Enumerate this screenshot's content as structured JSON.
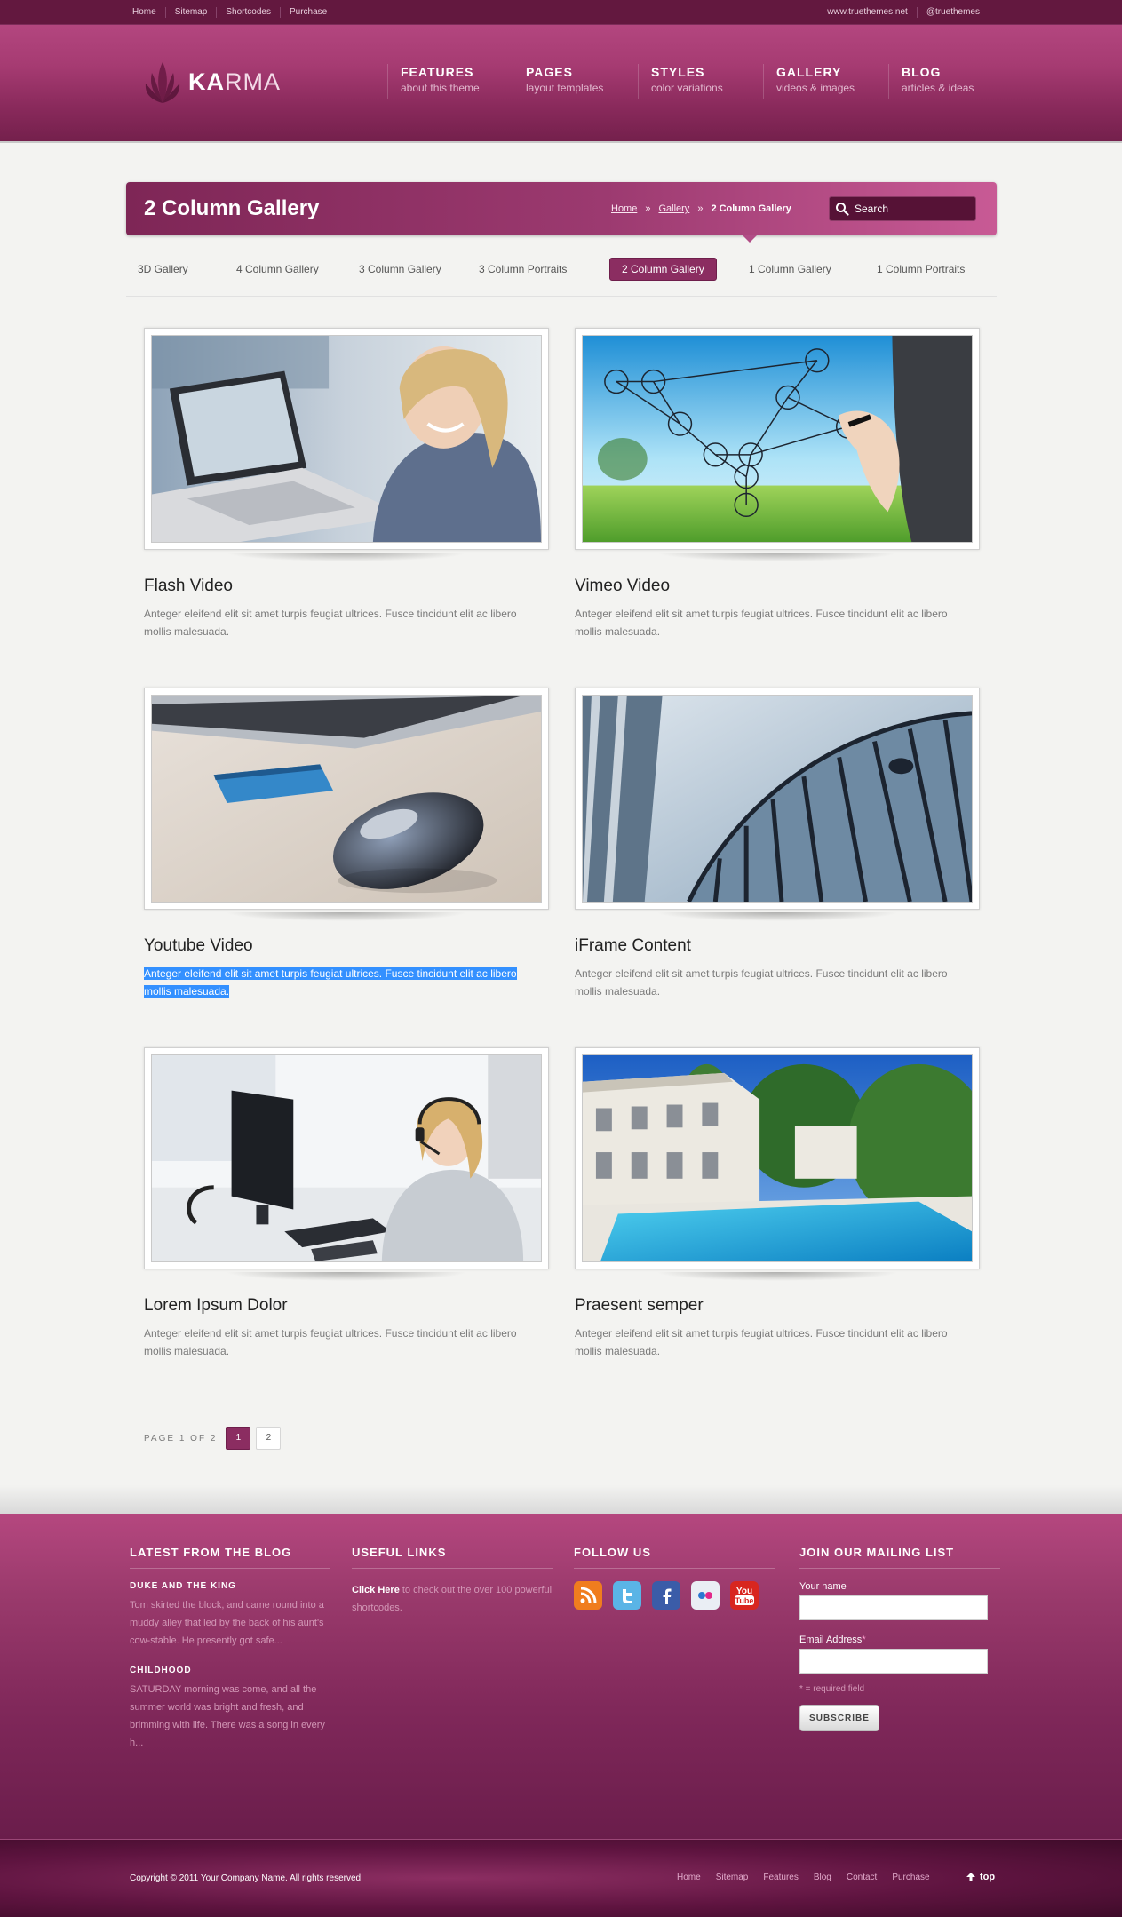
{
  "utility": {
    "left_links": [
      "Home",
      "Sitemap",
      "Shortcodes",
      "Purchase"
    ],
    "right_links": [
      "www.truethemes.net",
      "@truethemes"
    ]
  },
  "header": {
    "logo_bold": "KA",
    "logo_light": "RMA",
    "nav": [
      {
        "title": "FEATURES",
        "sub": "about this theme"
      },
      {
        "title": "PAGES",
        "sub": "layout templates"
      },
      {
        "title": "STYLES",
        "sub": "color variations"
      },
      {
        "title": "GALLERY",
        "sub": "videos & images"
      },
      {
        "title": "BLOG",
        "sub": "articles & ideas"
      }
    ]
  },
  "banner": {
    "title": "2 Column Gallery",
    "breadcrumb": [
      "Home",
      "Gallery",
      "2 Column Gallery"
    ],
    "separator": "»",
    "search_placeholder": "Search"
  },
  "filters": {
    "tabs": [
      "3D Gallery",
      "4 Column Gallery",
      "3 Column Gallery",
      "3 Column Portraits",
      "2 Column Gallery",
      "1 Column Gallery",
      "1 Column Portraits"
    ],
    "active": "2 Column Gallery"
  },
  "gallery": {
    "items": [
      {
        "title": "Flash Video",
        "desc": "Anteger eleifend elit sit amet turpis feugiat ultrices. Fusce tincidunt elit ac libero mollis malesuada.",
        "image": "woman-laptop"
      },
      {
        "title": "Vimeo Video",
        "desc": "Anteger eleifend elit sit amet turpis feugiat ultrices. Fusce tincidunt elit ac libero mollis malesuada.",
        "image": "network-diagram-hand"
      },
      {
        "title": "Youtube Video",
        "desc": "Anteger eleifend elit sit amet turpis feugiat ultrices. Fusce tincidunt elit ac libero mollis malesuada.",
        "image": "mouse-credit-card"
      },
      {
        "title": "iFrame Content",
        "desc": "Anteger eleifend elit sit amet turpis feugiat ultrices. Fusce tincidunt elit ac libero mollis malesuada.",
        "image": "glass-building"
      },
      {
        "title": "Lorem Ipsum Dolor",
        "desc": "Anteger eleifend elit sit amet turpis feugiat ultrices. Fusce tincidunt elit ac libero mollis malesuada.",
        "image": "headset-office"
      },
      {
        "title": "Praesent semper",
        "desc": "Anteger eleifend elit sit amet turpis feugiat ultrices. Fusce tincidunt elit ac libero mollis malesuada.",
        "image": "villa-pool"
      }
    ]
  },
  "pagination": {
    "label": "PAGE 1 OF 2",
    "pages": [
      "1",
      "2"
    ],
    "current": "1"
  },
  "footer": {
    "blog": {
      "heading": "LATEST FROM THE BLOG",
      "posts": [
        {
          "title": "DUKE AND THE KING",
          "excerpt": "Tom skirted the block, and came round into a muddy alley that led by the back of his aunt's cow-stable. He presently got safe..."
        },
        {
          "title": "CHILDHOOD",
          "excerpt": "SATURDAY morning was come, and all the summer world was bright and fresh, and brimming with life. There was a song in every h..."
        }
      ]
    },
    "links": {
      "heading": "USEFUL LINKS",
      "strong": "Click Here",
      "text": " to check out the over 100 powerful shortcodes."
    },
    "follow": {
      "heading": "FOLLOW US",
      "icons": [
        "rss-icon",
        "twitter-icon",
        "facebook-icon",
        "flickr-icon",
        "youtube-icon"
      ],
      "youtube_text": [
        "You",
        "Tube"
      ]
    },
    "mailing": {
      "heading": "JOIN OUR MAILING LIST",
      "name_label": "Your name",
      "email_label": "Email Address",
      "required_mark": "*",
      "note": "* = required field",
      "button": "SUBSCRIBE"
    }
  },
  "bottom": {
    "copyright": "Copyright © 2011 Your Company Name. All rights reserved.",
    "links": [
      "Home",
      "Sitemap",
      "Features",
      "Blog",
      "Contact",
      "Purchase"
    ],
    "top": "top"
  },
  "colors": {
    "brand": "#8b2d61",
    "header_top": "#b3467f",
    "utility_bg": "#63183f"
  }
}
